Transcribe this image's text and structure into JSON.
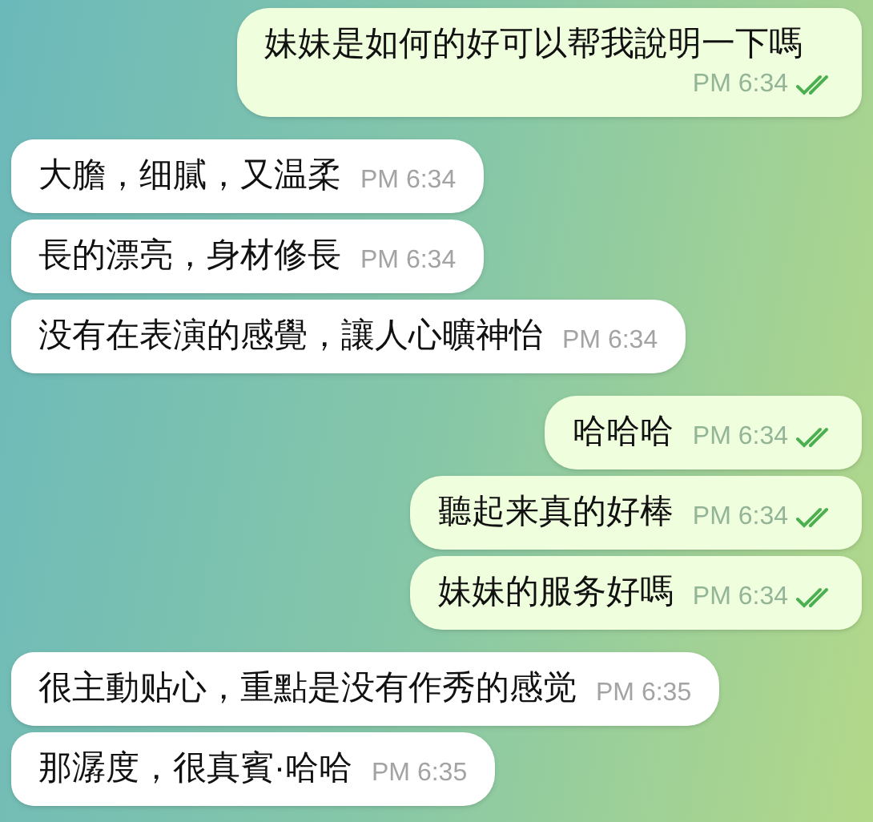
{
  "messages": [
    {
      "kind": "outgoing",
      "text": "妹妹是如何的好可以帮我說明一下嗎",
      "time": "PM 6:34",
      "read": true
    },
    {
      "kind": "incoming",
      "text": "大膽，细膩，又温柔",
      "time": "PM 6:34"
    },
    {
      "kind": "incoming",
      "text": "長的漂亮，身材修長",
      "time": "PM 6:34"
    },
    {
      "kind": "incoming",
      "text": "没有在表演的感覺，讓人心曠神怡",
      "time": "PM 6:34"
    },
    {
      "kind": "outgoing",
      "text": "哈哈哈",
      "time": "PM 6:34",
      "read": true
    },
    {
      "kind": "outgoing",
      "text": "聽起来真的好棒",
      "time": "PM 6:34",
      "read": true
    },
    {
      "kind": "outgoing",
      "text": "妹妹的服务好嗎",
      "time": "PM 6:34",
      "read": true
    },
    {
      "kind": "incoming",
      "text": "很主動贴心，重點是没有作秀的感觉",
      "time": "PM 6:35"
    },
    {
      "kind": "incoming",
      "text": "那潺度，很真賓·哈哈",
      "time": "PM 6:35"
    }
  ]
}
